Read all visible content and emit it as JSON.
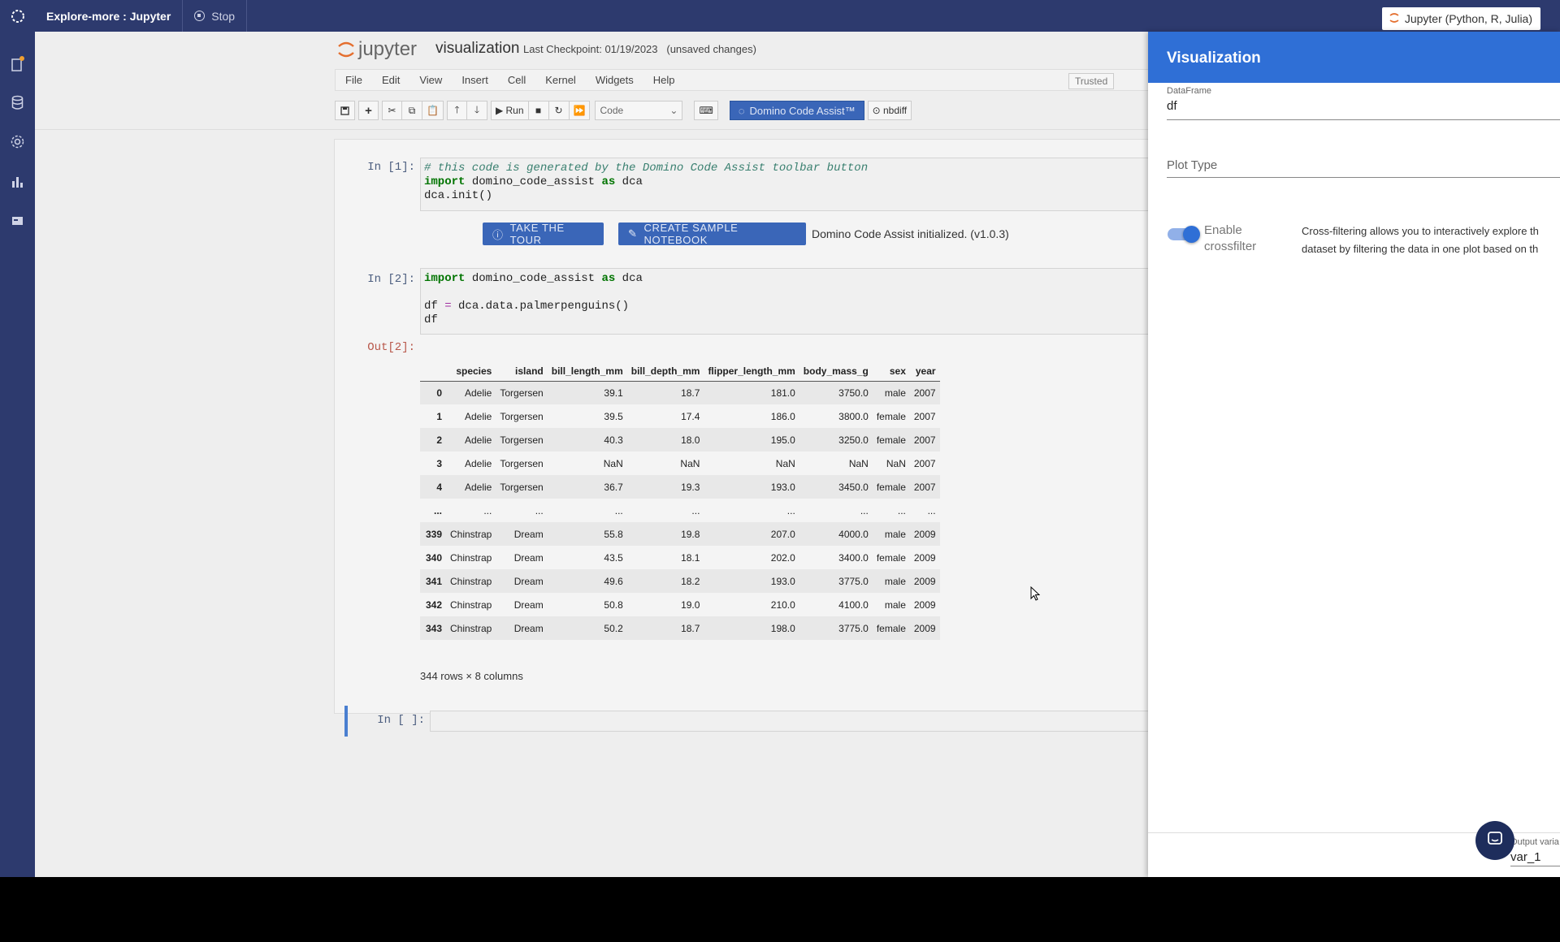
{
  "topbar": {
    "project_title": "Explore-more : Jupyter",
    "stop_label": "Stop",
    "environment_label": "Jupyter (Python, R, Julia)"
  },
  "jupyter": {
    "logo_text": "jupyter",
    "notebook_name": "visualization",
    "checkpoint": "Last Checkpoint: 01/19/2023",
    "unsaved": "(unsaved changes)",
    "menu": [
      "File",
      "Edit",
      "View",
      "Insert",
      "Cell",
      "Kernel",
      "Widgets",
      "Help"
    ],
    "trusted": "Trusted",
    "toolbar": {
      "run_label": "Run",
      "cell_type": "Code",
      "dca_label": "Domino Code Assist™",
      "nbdiff_label": "nbdiff"
    }
  },
  "cells": {
    "c1": {
      "prompt": "In [1]:",
      "line1": "# this code is generated by the Domino Code Assist toolbar button",
      "line2_kw": "import",
      "line2_a": " domino_code_assist ",
      "line2_kw2": "as",
      "line2_b": " dca",
      "line3": "dca.init()"
    },
    "c1_output": {
      "tour_button": "TAKE THE TOUR",
      "sample_button": "CREATE SAMPLE NOTEBOOK",
      "init_text": "Domino Code Assist initialized. (v1.0.3)"
    },
    "c2": {
      "prompt": "In [2]:",
      "line1_kw": "import",
      "line1_a": " domino_code_assist ",
      "line1_kw2": "as",
      "line1_b": " dca",
      "line3_a": "df ",
      "line3_op": "=",
      "line3_b": " dca.data.palmerpenguins()",
      "line4": "df"
    },
    "c2_output": {
      "prompt": "Out[2]:",
      "columns": [
        "",
        "species",
        "island",
        "bill_length_mm",
        "bill_depth_mm",
        "flipper_length_mm",
        "body_mass_g",
        "sex",
        "year"
      ],
      "rows": [
        [
          "0",
          "Adelie",
          "Torgersen",
          "39.1",
          "18.7",
          "181.0",
          "3750.0",
          "male",
          "2007"
        ],
        [
          "1",
          "Adelie",
          "Torgersen",
          "39.5",
          "17.4",
          "186.0",
          "3800.0",
          "female",
          "2007"
        ],
        [
          "2",
          "Adelie",
          "Torgersen",
          "40.3",
          "18.0",
          "195.0",
          "3250.0",
          "female",
          "2007"
        ],
        [
          "3",
          "Adelie",
          "Torgersen",
          "NaN",
          "NaN",
          "NaN",
          "NaN",
          "NaN",
          "2007"
        ],
        [
          "4",
          "Adelie",
          "Torgersen",
          "36.7",
          "19.3",
          "193.0",
          "3450.0",
          "female",
          "2007"
        ],
        [
          "...",
          "...",
          "...",
          "...",
          "...",
          "...",
          "...",
          "...",
          "..."
        ],
        [
          "339",
          "Chinstrap",
          "Dream",
          "55.8",
          "19.8",
          "207.0",
          "4000.0",
          "male",
          "2009"
        ],
        [
          "340",
          "Chinstrap",
          "Dream",
          "43.5",
          "18.1",
          "202.0",
          "3400.0",
          "female",
          "2009"
        ],
        [
          "341",
          "Chinstrap",
          "Dream",
          "49.6",
          "18.2",
          "193.0",
          "3775.0",
          "male",
          "2009"
        ],
        [
          "342",
          "Chinstrap",
          "Dream",
          "50.8",
          "19.0",
          "210.0",
          "4100.0",
          "male",
          "2009"
        ],
        [
          "343",
          "Chinstrap",
          "Dream",
          "50.2",
          "18.7",
          "198.0",
          "3775.0",
          "female",
          "2009"
        ]
      ],
      "shape": "344 rows × 8 columns"
    },
    "c3": {
      "prompt": "In [ ]:"
    }
  },
  "panel": {
    "title": "Visualization",
    "dataframe_label": "DataFrame",
    "dataframe_value": "df",
    "plot_type_placeholder": "Plot Type",
    "crossfilter_label_1": "Enable",
    "crossfilter_label_2": "crossfilter",
    "crossfilter_enabled": true,
    "help_line1": "Cross-filtering allows you to interactively explore th",
    "help_line2": "dataset by filtering the data in one plot based on th",
    "output_var_label": "Output varia",
    "output_var_value": "var_1"
  },
  "colors": {
    "nav": "#2d3a6e",
    "accent": "#2f6fd6"
  }
}
